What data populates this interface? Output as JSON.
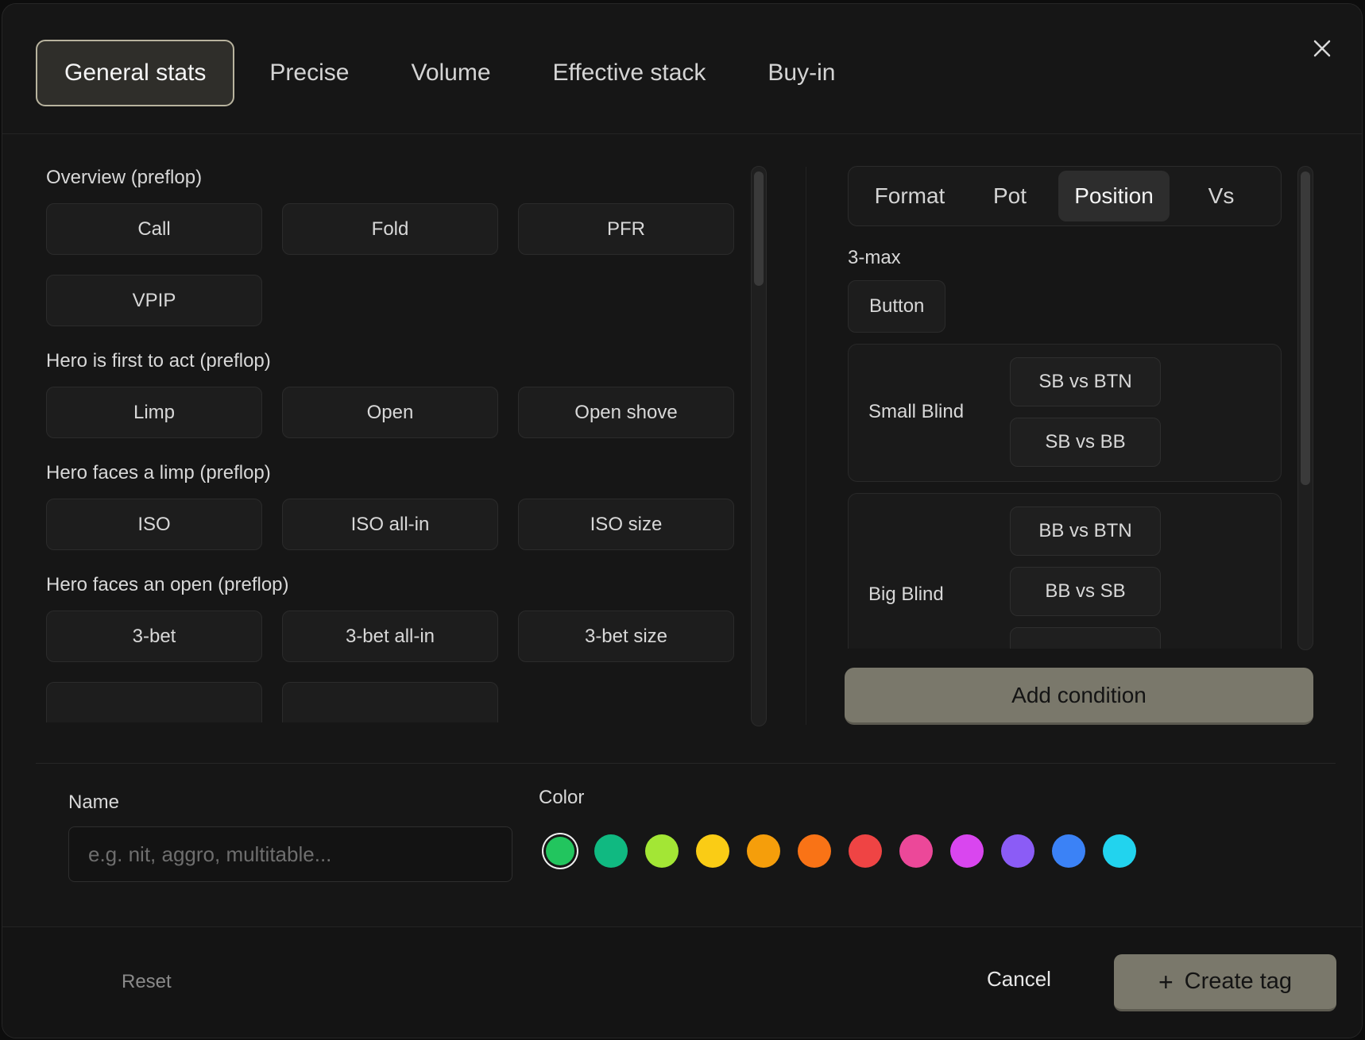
{
  "top_tabs": [
    {
      "label": "General stats",
      "active": true
    },
    {
      "label": "Precise",
      "active": false
    },
    {
      "label": "Volume",
      "active": false
    },
    {
      "label": "Effective stack",
      "active": false
    },
    {
      "label": "Buy-in",
      "active": false
    }
  ],
  "sections": [
    {
      "title": "Overview (preflop)",
      "buttons": [
        "Call",
        "Fold",
        "PFR",
        "VPIP"
      ]
    },
    {
      "title": "Hero is first to act (preflop)",
      "buttons": [
        "Limp",
        "Open",
        "Open shove"
      ]
    },
    {
      "title": "Hero faces a limp (preflop)",
      "buttons": [
        "ISO",
        "ISO all-in",
        "ISO size"
      ]
    },
    {
      "title": "Hero faces an open (preflop)",
      "buttons": [
        "3-bet",
        "3-bet all-in",
        "3-bet size"
      ]
    }
  ],
  "condition_tabs": [
    {
      "label": "Format",
      "active": false
    },
    {
      "label": "Pot",
      "active": false
    },
    {
      "label": "Position",
      "active": true
    },
    {
      "label": "Vs",
      "active": false
    }
  ],
  "position": {
    "format_label": "3-max",
    "button_label": "Button",
    "small_blind": {
      "label": "Small Blind",
      "options": [
        "SB vs BTN",
        "SB vs BB"
      ]
    },
    "big_blind": {
      "label": "Big Blind",
      "options": [
        "BB vs BTN",
        "BB vs SB"
      ]
    }
  },
  "add_condition_label": "Add condition",
  "form": {
    "name_label": "Name",
    "name_placeholder": "e.g. nit, aggro, multitable...",
    "color_label": "Color",
    "colors": [
      "#22c55e",
      "#10b981",
      "#a3e635",
      "#facc15",
      "#f59e0b",
      "#f97316",
      "#ef4444",
      "#ec4899",
      "#d946ef",
      "#8b5cf6",
      "#3b82f6",
      "#22d3ee"
    ],
    "selected_color": "#22c55e"
  },
  "footer": {
    "reset_label": "Reset",
    "cancel_label": "Cancel",
    "create_label": "Create tag"
  }
}
